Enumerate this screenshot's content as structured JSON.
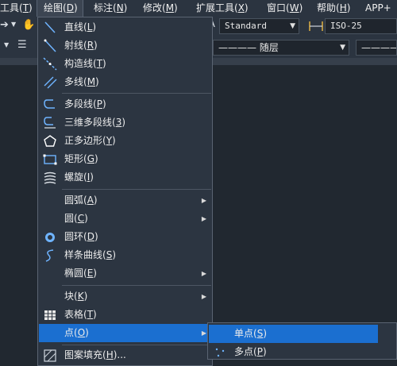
{
  "menubar": {
    "items": [
      {
        "text": "工具(",
        "key": "T",
        "tail": ")"
      },
      {
        "text": "绘图(",
        "key": "D",
        "tail": ")"
      },
      {
        "text": "标注(",
        "key": "N",
        "tail": ")"
      },
      {
        "text": "修改(",
        "key": "M",
        "tail": ")"
      },
      {
        "text": "扩展工具(",
        "key": "X",
        "tail": ")"
      },
      {
        "text": "窗口(",
        "key": "W",
        "tail": ")"
      },
      {
        "text": "帮助(",
        "key": "H",
        "tail": ")"
      },
      {
        "text": "APP+",
        "key": "",
        "tail": ""
      }
    ]
  },
  "toolbar": {
    "text_style": "Standard",
    "dim_style": "ISO-25",
    "linetype1": "随层",
    "linetype_line": "————",
    "linetype2_line": "————"
  },
  "draw_menu": {
    "items": [
      {
        "text": "直线(",
        "key": "L",
        "tail": ")",
        "icon": "line-icon",
        "submenu": false
      },
      {
        "text": "射线(",
        "key": "R",
        "tail": ")",
        "icon": "ray-icon",
        "submenu": false
      },
      {
        "text": "构造线(",
        "key": "T",
        "tail": ")",
        "icon": "construction-line-icon",
        "submenu": false
      },
      {
        "text": "多线(",
        "key": "M",
        "tail": ")",
        "icon": "multiline-icon",
        "submenu": false
      },
      {
        "text": "多段线(",
        "key": "P",
        "tail": ")",
        "icon": "polyline-icon",
        "submenu": false
      },
      {
        "text": "三维多段线(",
        "key": "3",
        "tail": ")",
        "icon": "3d-polyline-icon",
        "submenu": false
      },
      {
        "text": "正多边形(",
        "key": "Y",
        "tail": ")",
        "icon": "polygon-icon",
        "submenu": false
      },
      {
        "text": "矩形(",
        "key": "G",
        "tail": ")",
        "icon": "rectangle-icon",
        "submenu": false
      },
      {
        "text": "螺旋(",
        "key": "I",
        "tail": ")",
        "icon": "helix-icon",
        "submenu": false
      },
      {
        "text": "圆弧(",
        "key": "A",
        "tail": ")",
        "icon": "",
        "submenu": true
      },
      {
        "text": "圆(",
        "key": "C",
        "tail": ")",
        "icon": "",
        "submenu": true
      },
      {
        "text": "圆环(",
        "key": "D",
        "tail": ")",
        "icon": "donut-icon",
        "submenu": false
      },
      {
        "text": "样条曲线(",
        "key": "S",
        "tail": ")",
        "icon": "spline-icon",
        "submenu": false
      },
      {
        "text": "椭圆(",
        "key": "E",
        "tail": ")",
        "icon": "",
        "submenu": true
      },
      {
        "text": "块(",
        "key": "K",
        "tail": ")",
        "icon": "",
        "submenu": true
      },
      {
        "text": "表格(",
        "key": "T",
        "tail": ")",
        "icon": "table-icon",
        "submenu": false
      },
      {
        "text": "点(",
        "key": "O",
        "tail": ")",
        "icon": "",
        "submenu": true
      },
      {
        "text": "图案填充(",
        "key": "H",
        "tail": ")...",
        "icon": "hatch-icon",
        "submenu": false
      }
    ]
  },
  "point_submenu": {
    "items": [
      {
        "text": "单点(",
        "key": "S",
        "tail": ")"
      },
      {
        "text": "多点(",
        "key": "P",
        "tail": ")"
      }
    ]
  }
}
